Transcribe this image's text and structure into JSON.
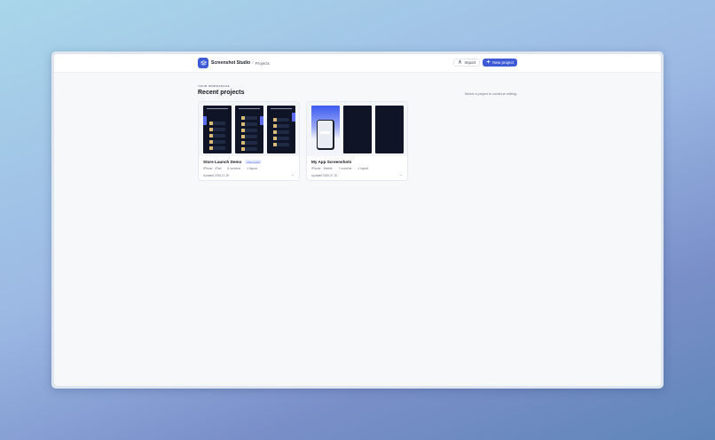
{
  "header": {
    "app_name": "Screenshot Studio",
    "separator": "/",
    "breadcrumb": "Projects",
    "import_label": "Import",
    "new_project_label": "New project",
    "accent_color": "#3e5bd6"
  },
  "workspace": {
    "eyebrow": "YOUR WORKSPACE",
    "title": "Recent projects",
    "hint": "Select a project to continue editing."
  },
  "projects": [
    {
      "name": "Store Launch Demo",
      "badge": "Most recent",
      "devices": "iPhone · iPad",
      "screens": "8 screens",
      "layouts": "1 layout",
      "updated": "Updated 2026-07-20"
    },
    {
      "name": "My App Screenshots",
      "devices": "iPhone · Mobile",
      "screens": "7 screens",
      "layouts": "1 layout",
      "updated": "Updated 2026-07-20"
    }
  ],
  "icons": {
    "logo": "layers-icon",
    "import": "import-icon",
    "new": "plus-icon",
    "card_menu": "chevron-down-icon"
  }
}
